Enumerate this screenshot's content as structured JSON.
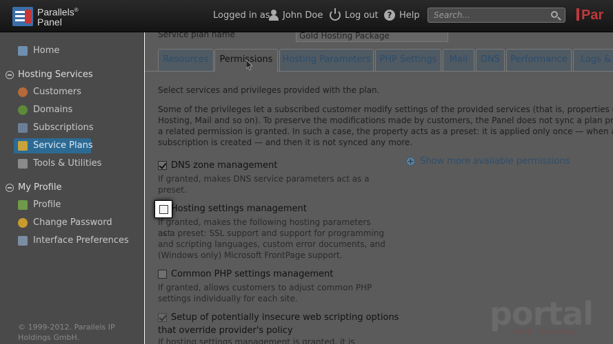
{
  "header": {
    "logo_line1": "Parallels",
    "logo_reg": "®",
    "logo_line2": "Panel",
    "logged_in_as": "Logged in as",
    "user_name": "John Doe",
    "logout_label": "Log out",
    "help_label": "Help",
    "search_placeholder": "Search...",
    "brand_right": "Par",
    "icons": [
      "user-icon",
      "power-icon",
      "help-icon",
      "search-icon"
    ]
  },
  "sidebar": {
    "home": "Home",
    "hosting_section": "Hosting Services",
    "hosting_items": [
      {
        "label": "Customers",
        "icon": "customers-icon",
        "color": "#b56a3a"
      },
      {
        "label": "Domains",
        "icon": "domains-icon",
        "color": "#5c8a3a"
      },
      {
        "label": "Subscriptions",
        "icon": "subscriptions-icon",
        "color": "#6b7f99"
      },
      {
        "label": "Service Plans",
        "icon": "service-plans-icon",
        "color": "#c7a33a"
      },
      {
        "label": "Tools & Utilities",
        "icon": "tools-icon",
        "color": "#8a8a8a"
      }
    ],
    "profile_section": "My Profile",
    "profile_items": [
      {
        "label": "Profile",
        "icon": "profile-icon",
        "color": "#6f9a4a"
      },
      {
        "label": "Change Password",
        "icon": "key-icon",
        "color": "#c99a2e"
      },
      {
        "label": "Interface Preferences",
        "icon": "preferences-icon",
        "color": "#7a8da3"
      }
    ],
    "active_item": "Service Plans",
    "copyright": "© 1999-2012. Parallels IP Holdings GmbH."
  },
  "main": {
    "plan_name_label": "Service plan name",
    "plan_name_value": "Gold Hosting Package",
    "tabs": [
      "Resources",
      "Permissions",
      "Hosting Parameters",
      "PHP Settings",
      "Mail",
      "DNS",
      "Performance",
      "Logs & S"
    ],
    "active_tab": "Permissions",
    "intro": "Select services and privileges provided with the plan.",
    "note_lines": [
      "Some of the privileges let a subscribed customer modify settings of the provided services (that is, properties of",
      "Hosting, Mail and so on). To preserve the modifications made by customers, the Panel does not sync a plan prop",
      "a related permission is granted. In such a case, the property acts as a preset: it is applied only once — when a",
      "subscription is created — and then it is not synced any more."
    ],
    "show_more": "Show more available permissions",
    "permissions": [
      {
        "label": "DNS zone management",
        "checked": true,
        "desc_lines": [
          "If granted, makes DNS service parameters act as a",
          "preset."
        ]
      },
      {
        "label": "Hosting settings management",
        "checked": false,
        "desc_lines": [
          "If granted, makes the following hosting parameters act",
          "as a preset: SSL support and support for programming",
          "and scripting languages, custom error documents, and",
          "(Windows only) Microsoft FrontPage support."
        ]
      },
      {
        "label": "Common PHP settings management",
        "checked": false,
        "desc_lines": [
          "If granted, allows customers to adjust common PHP",
          "settings individually for each site."
        ]
      },
      {
        "label_lines": [
          "Setup of potentially insecure web scripting options",
          "that override provider's policy"
        ],
        "checked": true,
        "desc_lines": [
          "If hosting settings management is granted, it is"
        ]
      }
    ]
  },
  "watermark": {
    "text": "portal",
    "sub": "web hosting"
  },
  "colors": {
    "accent": "#2c6a94",
    "brand": "#c0393b",
    "link": "#2e4e6c"
  }
}
